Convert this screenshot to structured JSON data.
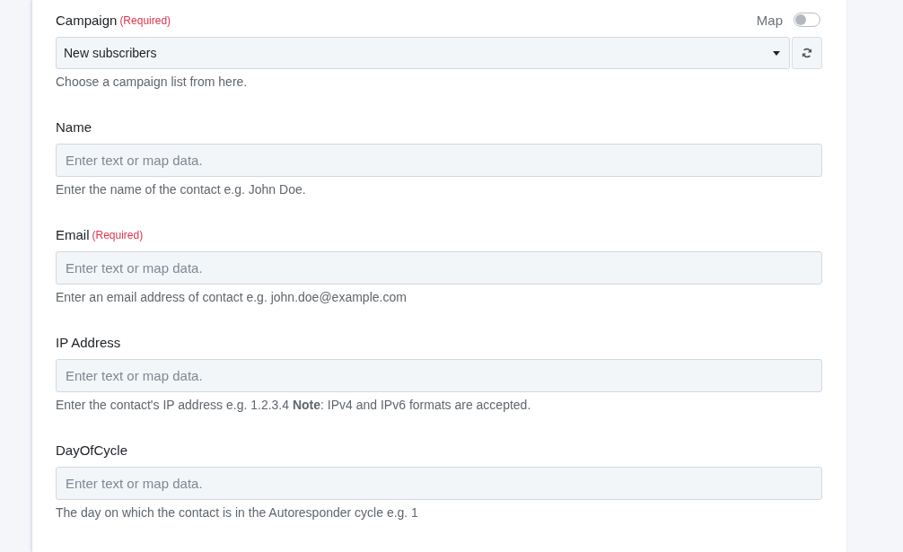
{
  "fields": [
    {
      "kind": "select",
      "label": "Campaign",
      "required_label": "(Required)",
      "map_toggle": {
        "label": "Map",
        "on": false
      },
      "value": "New subscribers",
      "help": "Choose a campaign list from here."
    },
    {
      "kind": "text",
      "label": "Name",
      "placeholder": "Enter text or map data.",
      "help": "Enter the name of the contact e.g. John Doe."
    },
    {
      "kind": "text",
      "label": "Email",
      "required_label": "(Required)",
      "placeholder": "Enter text or map data.",
      "help": "Enter an email address of contact e.g. john.doe@example.com"
    },
    {
      "kind": "text",
      "label": "IP Address",
      "placeholder": "Enter text or map data.",
      "help": "Enter the contact's IP address e.g. 1.2.3.4 **Note**: IPv4 and IPv6 formats are accepted."
    },
    {
      "kind": "text",
      "label": "DayOfCycle",
      "placeholder": "Enter text or map data.",
      "help": "The day on which the contact is in the Autoresponder cycle e.g. 1"
    }
  ]
}
